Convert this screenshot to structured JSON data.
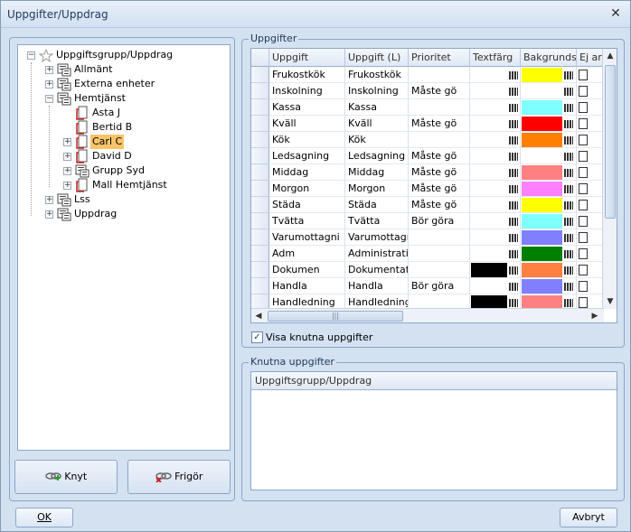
{
  "window": {
    "title": "Uppgifter/Uppdrag",
    "close_label": "✕"
  },
  "tree": {
    "nodes": [
      {
        "label": "Uppgiftsgrupp/Uppdrag",
        "expander": "−",
        "icon": "root-icon"
      },
      {
        "label": "Allmänt",
        "expander": "+",
        "icon": "group-icon"
      },
      {
        "label": "Externa enheter",
        "expander": "+",
        "icon": "group-icon"
      },
      {
        "label": "Hemtjänst",
        "expander": "−",
        "icon": "group-icon"
      },
      {
        "label": "Asta J",
        "expander": "",
        "icon": "document-icon"
      },
      {
        "label": "Bertid B",
        "expander": "",
        "icon": "document-icon"
      },
      {
        "label": "Carl C",
        "expander": "+",
        "icon": "document-icon",
        "selected": true
      },
      {
        "label": "David D",
        "expander": "+",
        "icon": "document-icon"
      },
      {
        "label": "Grupp Syd",
        "expander": "+",
        "icon": "group-icon"
      },
      {
        "label": "Mall Hemtjänst",
        "expander": "+",
        "icon": "document-icon"
      },
      {
        "label": "Lss",
        "expander": "+",
        "icon": "group-icon"
      },
      {
        "label": "Uppdrag",
        "expander": "+",
        "icon": "group-icon"
      }
    ]
  },
  "buttons": {
    "knyt": "Knyt",
    "frigor": "Frigör",
    "ok": "OK",
    "avbryt": "Avbryt"
  },
  "uppgifter": {
    "caption": "Uppgifter",
    "columns": [
      "Uppgift",
      "Uppgift (L)",
      "Prioritet",
      "Textfärg",
      "Bakgrundsf",
      "Ej ar"
    ],
    "rows": [
      {
        "uppgift": "Frukostkök",
        "uppgift_l": "Frukostkök",
        "prioritet": "",
        "textfarg": "",
        "bakgrund": "#ffff00"
      },
      {
        "uppgift": "Inskolning",
        "uppgift_l": "Inskolning",
        "prioritet": "Måste gö",
        "textfarg": "",
        "bakgrund": "#ffffff"
      },
      {
        "uppgift": "Kassa",
        "uppgift_l": "Kassa",
        "prioritet": "",
        "textfarg": "",
        "bakgrund": "#80ffff"
      },
      {
        "uppgift": "Kväll",
        "uppgift_l": "Kväll",
        "prioritet": "Måste gö",
        "textfarg": "",
        "bakgrund": "#ff0000"
      },
      {
        "uppgift": "Kök",
        "uppgift_l": "Kök",
        "prioritet": "",
        "textfarg": "",
        "bakgrund": "#ff8000"
      },
      {
        "uppgift": "Ledsagning",
        "uppgift_l": "Ledsagning",
        "prioritet": "Måste gö",
        "textfarg": "",
        "bakgrund": "#ffffff"
      },
      {
        "uppgift": "Middag",
        "uppgift_l": "Middag",
        "prioritet": "Måste gö",
        "textfarg": "",
        "bakgrund": "#ff8080"
      },
      {
        "uppgift": "Morgon",
        "uppgift_l": "Morgon",
        "prioritet": "Måste gö",
        "textfarg": "",
        "bakgrund": "#ff80ff"
      },
      {
        "uppgift": "Städa",
        "uppgift_l": "Städa",
        "prioritet": "Måste gö",
        "textfarg": "",
        "bakgrund": "#ffff00"
      },
      {
        "uppgift": "Tvätta",
        "uppgift_l": "Tvätta",
        "prioritet": "Bör göra",
        "textfarg": "",
        "bakgrund": "#80ffff"
      },
      {
        "uppgift": "Varumottagni",
        "uppgift_l": "Varumottagni",
        "prioritet": "",
        "textfarg": "",
        "bakgrund": "#8080ff"
      },
      {
        "uppgift": "Adm",
        "uppgift_l": "Administratio",
        "prioritet": "",
        "textfarg": "",
        "bakgrund": "#008000"
      },
      {
        "uppgift": "Dokumen",
        "uppgift_l": "Dokumentatio",
        "prioritet": "",
        "textfarg": "#000000",
        "bakgrund": "#ff8040"
      },
      {
        "uppgift": "Handla",
        "uppgift_l": "Handla",
        "prioritet": "Bör göra",
        "textfarg": "",
        "bakgrund": "#8080ff"
      },
      {
        "uppgift": "Handledning",
        "uppgift_l": "Handledning",
        "prioritet": "",
        "textfarg": "#000000",
        "bakgrund": "#ff8080"
      }
    ],
    "hscroll_grip": "|||",
    "show_linked_label": "Visa knutna uppgifter",
    "show_linked_checked": true
  },
  "knutna": {
    "caption": "Knutna uppgifter",
    "column": "Uppgiftsgrupp/Uppdrag"
  }
}
